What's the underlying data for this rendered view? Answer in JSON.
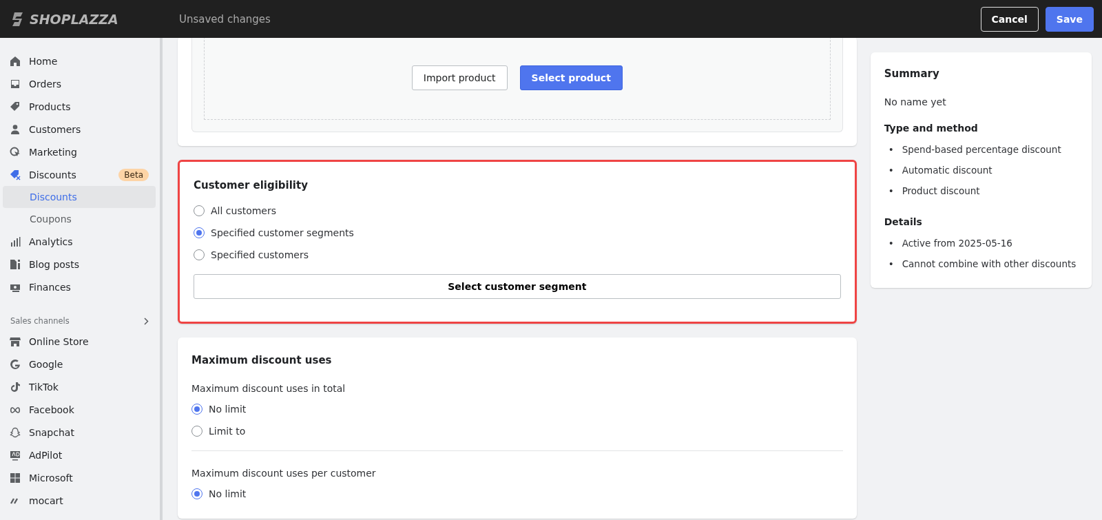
{
  "topbar": {
    "logo": "SHOPLAZZA",
    "status": "Unsaved changes",
    "buttons": [
      {
        "label": "Cancel",
        "kind": "secondary"
      },
      {
        "label": "Save",
        "kind": "primary"
      }
    ]
  },
  "sidebar": {
    "items": [
      {
        "label": "Home",
        "active": false
      },
      {
        "label": "Orders",
        "active": false
      },
      {
        "label": "Products",
        "active": false
      },
      {
        "label": "Customers",
        "active": false
      },
      {
        "label": "Marketing",
        "active": false
      },
      {
        "label": "Discounts",
        "active": true,
        "badge": "Beta",
        "children": [
          {
            "label": "Discounts",
            "selected": true
          },
          {
            "label": "Coupons",
            "selected": false
          }
        ]
      },
      {
        "label": "Analytics",
        "active": false
      },
      {
        "label": "Blog posts",
        "active": false
      },
      {
        "label": "Finances",
        "active": false
      }
    ],
    "section_title": "Sales channels",
    "channels": [
      {
        "label": "Online Store"
      },
      {
        "label": "Google"
      },
      {
        "label": "TikTok"
      },
      {
        "label": "Facebook"
      },
      {
        "label": "Snapchat"
      },
      {
        "label": "AdPilot"
      },
      {
        "label": "Microsoft"
      },
      {
        "label": "mocart"
      }
    ]
  },
  "product_card": {
    "buttons": [
      {
        "label": "Import product",
        "kind": "secondary"
      },
      {
        "label": "Select product",
        "kind": "primary"
      }
    ]
  },
  "eligibility_card": {
    "title": "Customer eligibility",
    "highlighted": true,
    "options": [
      {
        "label": "All customers",
        "selected": false
      },
      {
        "label": "Specified customer segments",
        "selected": true
      },
      {
        "label": "Specified customers",
        "selected": false
      }
    ],
    "button": "Select customer segment"
  },
  "max_uses_card": {
    "title": "Maximum discount uses",
    "groups": [
      {
        "label": "Maximum discount uses in total",
        "options": [
          {
            "label": "No limit",
            "selected": true
          },
          {
            "label": "Limit to",
            "selected": false
          }
        ]
      },
      {
        "label": "Maximum discount uses per customer",
        "options": [
          {
            "label": "No limit",
            "selected": true
          }
        ]
      }
    ]
  },
  "summary": {
    "title": "Summary",
    "name": "No name yet",
    "sections": [
      {
        "title": "Type and method",
        "bullet": "•",
        "items": [
          "Spend-based percentage discount",
          "Automatic discount",
          "Product discount"
        ]
      },
      {
        "title": "Details",
        "bullet": "•",
        "items": [
          "Active from 2025-05-16",
          "Cannot combine with other discounts"
        ]
      }
    ]
  }
}
